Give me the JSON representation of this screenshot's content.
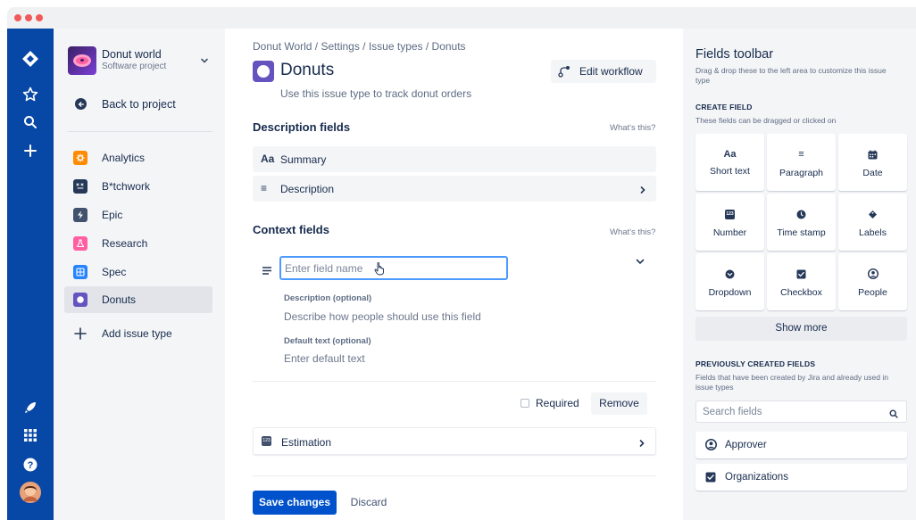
{
  "colors": {
    "nav_bg": "#0747a6",
    "primary": "#0052cc",
    "sidebar_bg": "#f4f5f7",
    "issue_type": "#6554c0",
    "focus_border": "#4c9aff"
  },
  "window": {
    "controls": [
      "close",
      "minimize",
      "zoom"
    ]
  },
  "global_nav": {
    "icons": [
      "jira-logo-icon",
      "star-icon",
      "search-icon",
      "plus-icon",
      "rocket-icon",
      "app-switcher-icon",
      "help-icon",
      "profile-avatar"
    ]
  },
  "project": {
    "name": "Donut world",
    "type": "Software project"
  },
  "sidebar": {
    "back_label": "Back to project",
    "issue_types": [
      {
        "label": "Analytics",
        "icon": "gear-icon",
        "color": "#ff8b00",
        "active": false
      },
      {
        "label": "B*tchwork",
        "icon": "bitchwork-icon",
        "color": "#253858",
        "active": false
      },
      {
        "label": "Epic",
        "icon": "lightning-icon",
        "color": "#42526e",
        "active": false
      },
      {
        "label": "Research",
        "icon": "flask-icon",
        "color": "#ff5fa2",
        "active": false
      },
      {
        "label": "Spec",
        "icon": "grid-icon",
        "color": "#2684ff",
        "active": false
      },
      {
        "label": "Donuts",
        "icon": "donut-icon",
        "color": "#6554c0",
        "active": true
      }
    ],
    "add_label": "Add issue type"
  },
  "main": {
    "breadcrumb": "Donut World  /  Settings  /  Issue types  /  Donuts",
    "title": "Donuts",
    "subtitle": "Use this issue type to track donut orders",
    "edit_workflow": "Edit workflow",
    "description_section": {
      "title": "Description fields",
      "help": "What's this?"
    },
    "description_fields": [
      {
        "icon": "Aa",
        "label": "Summary"
      },
      {
        "icon": "≡",
        "label": "Description",
        "expandable": true
      }
    ],
    "context_section": {
      "title": "Context fields",
      "help": "What's this?"
    },
    "new_field": {
      "name_placeholder": "Enter field name",
      "description_label": "Description (optional)",
      "description_placeholder": "Describe how people should use this field",
      "default_label": "Default text (optional)",
      "default_placeholder": "Enter default text",
      "required_label": "Required",
      "required_checked": false,
      "remove_label": "Remove"
    },
    "estimation": {
      "icon_text": "123",
      "label": "Estimation"
    },
    "save_label": "Save changes",
    "discard_label": "Discard"
  },
  "toolbar": {
    "title": "Fields toolbar",
    "description": "Drag & drop these to the left area to customize this issue type",
    "create_heading": "CREATE FIELD",
    "create_sub": "These fields can be dragged or clicked on",
    "fields": [
      {
        "label": "Short text",
        "icon": "text-icon",
        "glyph": "Aa"
      },
      {
        "label": "Paragraph",
        "icon": "paragraph-icon",
        "glyph": "≡"
      },
      {
        "label": "Date",
        "icon": "calendar-icon",
        "glyph": ""
      },
      {
        "label": "Number",
        "icon": "number-icon",
        "glyph": "123"
      },
      {
        "label": "Time stamp",
        "icon": "clock-icon",
        "glyph": ""
      },
      {
        "label": "Labels",
        "icon": "tag-icon",
        "glyph": ""
      },
      {
        "label": "Dropdown",
        "icon": "dropdown-icon",
        "glyph": ""
      },
      {
        "label": "Checkbox",
        "icon": "checkbox-icon",
        "glyph": ""
      },
      {
        "label": "People",
        "icon": "person-icon",
        "glyph": ""
      }
    ],
    "show_more": "Show more",
    "previous_heading": "PREVIOUSLY CREATED FIELDS",
    "previous_sub": "Fields that have been created by Jira and already used in issue types",
    "search_placeholder": "Search fields",
    "previous_fields": [
      {
        "label": "Approver",
        "icon": "person-icon"
      },
      {
        "label": "Organizations",
        "icon": "checkbox-icon"
      }
    ]
  }
}
